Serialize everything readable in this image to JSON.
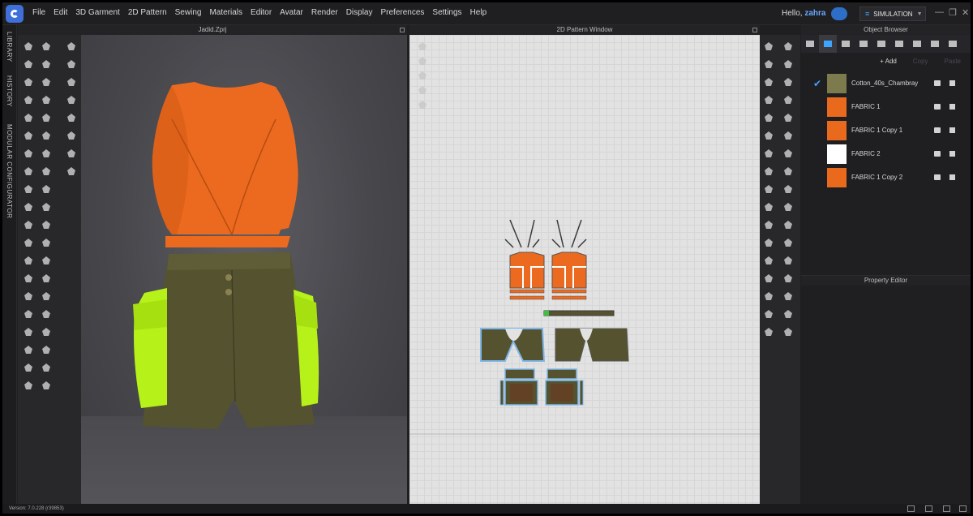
{
  "app": {
    "menu": [
      "File",
      "Edit",
      "3D Garment",
      "2D Pattern",
      "Sewing",
      "Materials",
      "Editor",
      "Avatar",
      "Render",
      "Display",
      "Preferences",
      "Settings",
      "Help"
    ],
    "greeting": "Hello,",
    "username": "zahra",
    "mode_label": "SIMULATION"
  },
  "sidebar_rail": {
    "labels": [
      "LIBRARY",
      "HISTORY",
      "MODULAR CONFIGURATOR"
    ]
  },
  "viewport3d": {
    "title": "Jadid.Zprj"
  },
  "pattern2d": {
    "title": "2D Pattern Window"
  },
  "object_browser": {
    "title": "Object Browser",
    "add_label": "+ Add",
    "copy_label": "Copy",
    "paste_label": "Paste",
    "fabrics": [
      {
        "name": "Cotton_40s_Chambray",
        "color": "#7d7a4e",
        "checked": true
      },
      {
        "name": "FABRIC 1",
        "color": "#e96a1c",
        "checked": false
      },
      {
        "name": "FABRIC 1 Copy 1",
        "color": "#e96a1c",
        "checked": false
      },
      {
        "name": "FABRIC 2",
        "color": "#ffffff",
        "checked": false
      },
      {
        "name": "FABRIC 1 Copy 2",
        "color": "#e96a1c",
        "checked": false
      }
    ]
  },
  "property_editor": {
    "title": "Property Editor"
  },
  "status_bar": {
    "version": "Version: 7.0.228 (r39853)"
  },
  "colors": {
    "accent": "#3ea5ff",
    "garment_top": "#ec6a1f",
    "garment_shorts": "#55532f",
    "pocket_neon": "#b6f21a"
  }
}
